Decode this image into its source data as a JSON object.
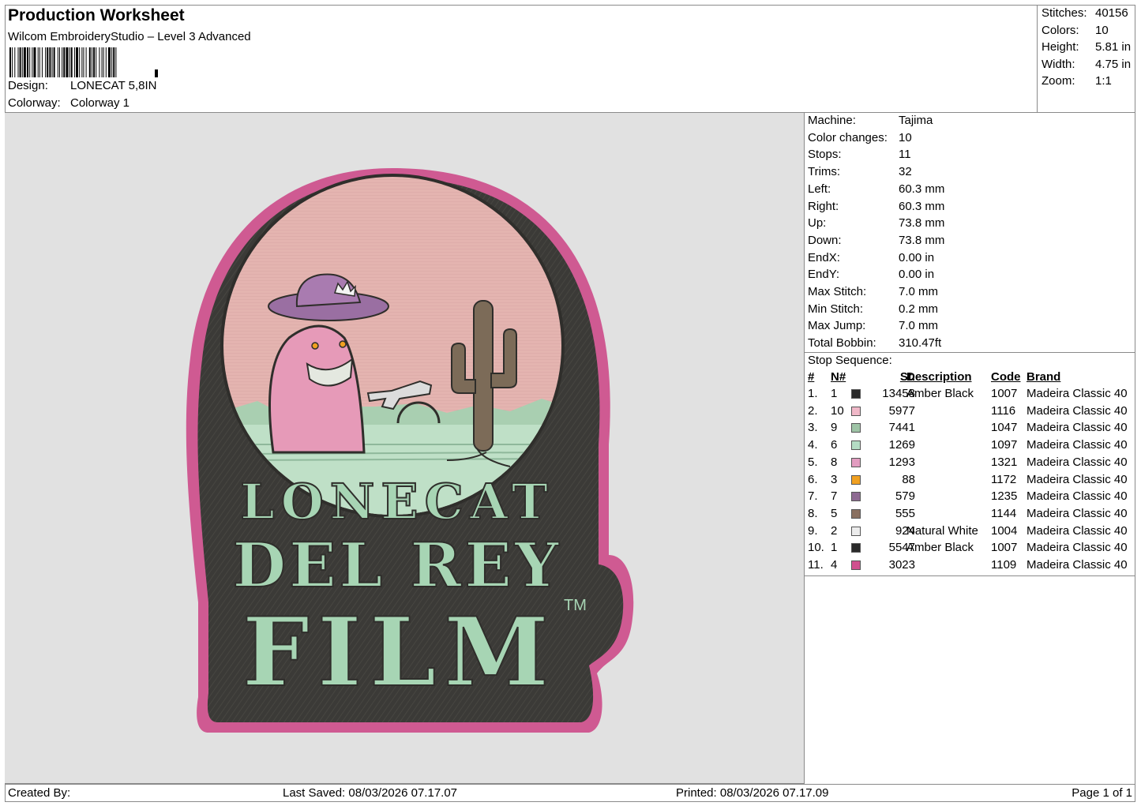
{
  "header": {
    "title": "Production Worksheet",
    "software": "Wilcom EmbroideryStudio – Level 3 Advanced",
    "design_label": "Design:",
    "design_value": "LONECAT 5,8IN",
    "colorway_label": "Colorway:",
    "colorway_value": "Colorway 1"
  },
  "stats": {
    "stitches_label": "Stitches:",
    "stitches_value": "40156",
    "colors_label": "Colors:",
    "colors_value": "10",
    "height_label": "Height:",
    "height_value": "5.81 in",
    "width_label": "Width:",
    "width_value": "4.75 in",
    "zoom_label": "Zoom:",
    "zoom_value": "1:1"
  },
  "properties": [
    {
      "label": "Machine:",
      "value": "Tajima"
    },
    {
      "label": "Color changes:",
      "value": "10"
    },
    {
      "label": "Stops:",
      "value": "11"
    },
    {
      "label": "Trims:",
      "value": "32"
    },
    {
      "label": "Left:",
      "value": "60.3 mm"
    },
    {
      "label": "Right:",
      "value": "60.3 mm"
    },
    {
      "label": "Up:",
      "value": "73.8 mm"
    },
    {
      "label": "Down:",
      "value": "73.8 mm"
    },
    {
      "label": "EndX:",
      "value": "0.00 in"
    },
    {
      "label": "EndY:",
      "value": "0.00 in"
    },
    {
      "label": "Max Stitch:",
      "value": "7.0 mm"
    },
    {
      "label": "Min Stitch:",
      "value": "0.2 mm"
    },
    {
      "label": "Max Jump:",
      "value": "7.0 mm"
    },
    {
      "label": "Total Bobbin:",
      "value": "310.47ft"
    }
  ],
  "stop_sequence": {
    "title": "Stop Sequence:",
    "headers": {
      "index": "#",
      "needle": "N#",
      "stitches": "St.",
      "description": "Description",
      "code": "Code",
      "brand": "Brand"
    },
    "rows": [
      {
        "index": "1.",
        "needle": "1",
        "color": "#2b2b2b",
        "stitches": "13458",
        "description": "Amber Black",
        "code": "1007",
        "brand": "Madeira Classic 40"
      },
      {
        "index": "2.",
        "needle": "10",
        "color": "#f0b8c8",
        "stitches": "5977",
        "description": "",
        "code": "1116",
        "brand": "Madeira Classic 40"
      },
      {
        "index": "3.",
        "needle": "9",
        "color": "#9ec4a6",
        "stitches": "7441",
        "description": "",
        "code": "1047",
        "brand": "Madeira Classic 40"
      },
      {
        "index": "4.",
        "needle": "6",
        "color": "#b4dcc4",
        "stitches": "1269",
        "description": "",
        "code": "1097",
        "brand": "Madeira Classic 40"
      },
      {
        "index": "5.",
        "needle": "8",
        "color": "#e29cc0",
        "stitches": "1293",
        "description": "",
        "code": "1321",
        "brand": "Madeira Classic 40"
      },
      {
        "index": "6.",
        "needle": "3",
        "color": "#f0a020",
        "stitches": "88",
        "description": "",
        "code": "1172",
        "brand": "Madeira Classic 40"
      },
      {
        "index": "7.",
        "needle": "7",
        "color": "#8e6a92",
        "stitches": "579",
        "description": "",
        "code": "1235",
        "brand": "Madeira Classic 40"
      },
      {
        "index": "8.",
        "needle": "5",
        "color": "#8a7060",
        "stitches": "555",
        "description": "",
        "code": "1144",
        "brand": "Madeira Classic 40"
      },
      {
        "index": "9.",
        "needle": "2",
        "color": "#ececec",
        "stitches": "924",
        "description": "Natural White",
        "code": "1004",
        "brand": "Madeira Classic 40"
      },
      {
        "index": "10.",
        "needle": "1",
        "color": "#2b2b2b",
        "stitches": "5547",
        "description": "Amber Black",
        "code": "1007",
        "brand": "Madeira Classic 40"
      },
      {
        "index": "11.",
        "needle": "4",
        "color": "#d0508e",
        "stitches": "3023",
        "description": "",
        "code": "1109",
        "brand": "Madeira Classic 40"
      }
    ]
  },
  "design_text": {
    "line1": "LONECAT",
    "line2": "DEL REY",
    "line3": "FILM",
    "trademark": "TM"
  },
  "footer": {
    "created_by": "Created By:",
    "last_saved": "Last Saved: 08/03/2026 07.17.07",
    "printed": "Printed: 08/03/2026 07.17.09",
    "page": "Page 1 of 1"
  }
}
